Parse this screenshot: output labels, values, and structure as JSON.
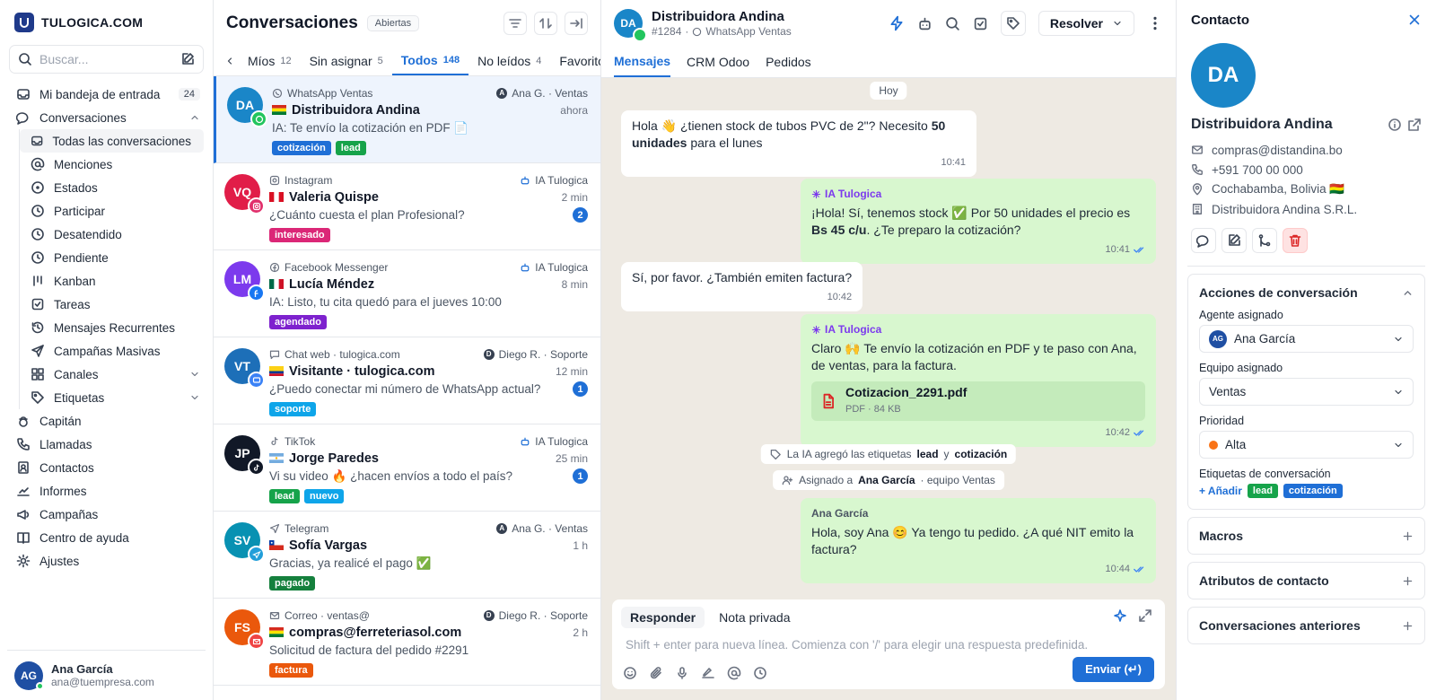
{
  "brand": {
    "name": "TULOGICA.COM"
  },
  "sidebar": {
    "search_placeholder": "Buscar...",
    "items": [
      {
        "label": "Mi bandeja de entrada",
        "count": "24"
      },
      {
        "label": "Conversaciones"
      },
      {
        "label": "Todas las conversaciones"
      },
      {
        "label": "Menciones"
      },
      {
        "label": "Estados"
      },
      {
        "label": "Participar"
      },
      {
        "label": "Desatendido"
      },
      {
        "label": "Pendiente"
      },
      {
        "label": "Kanban"
      },
      {
        "label": "Tareas"
      },
      {
        "label": "Mensajes Recurrentes"
      },
      {
        "label": "Campañas Masivas"
      },
      {
        "label": "Canales"
      },
      {
        "label": "Etiquetas"
      },
      {
        "label": "Capitán"
      },
      {
        "label": "Llamadas"
      },
      {
        "label": "Contactos"
      },
      {
        "label": "Informes"
      },
      {
        "label": "Campañas"
      },
      {
        "label": "Centro de ayuda"
      },
      {
        "label": "Ajustes"
      }
    ],
    "user": {
      "initials": "AG",
      "name": "Ana García",
      "email": "ana@tuempresa.com"
    }
  },
  "list": {
    "title": "Conversaciones",
    "status": "Abiertas",
    "tabs": [
      {
        "label": "Míos",
        "count": "12"
      },
      {
        "label": "Sin asignar",
        "count": "5"
      },
      {
        "label": "Todos",
        "count": "148"
      },
      {
        "label": "No leídos",
        "count": "4"
      },
      {
        "label": "Favoritos",
        "count": ""
      }
    ],
    "conversations": [
      {
        "initials": "DA",
        "channel": "WhatsApp Ventas",
        "agent": "Ana G. · Ventas",
        "agent_initial": "A",
        "name": "Distribuidora Andina",
        "time": "ahora",
        "preview": "IA: Te envío la cotización en PDF 📄",
        "unread": "",
        "tags": [
          {
            "label": "cotización",
            "color": "#1f6fd6"
          },
          {
            "label": "lead",
            "color": "#16a34a"
          }
        ]
      },
      {
        "initials": "VQ",
        "channel": "Instagram",
        "agent": "IA Tulogica",
        "agent_initial": "",
        "name": "Valeria Quispe",
        "time": "2 min",
        "preview": "¿Cuánto cuesta el plan Profesional?",
        "unread": "2",
        "tags": [
          {
            "label": "interesado",
            "color": "#db2777"
          }
        ]
      },
      {
        "initials": "LM",
        "channel": "Facebook Messenger",
        "agent": "IA Tulogica",
        "agent_initial": "",
        "name": "Lucía Méndez",
        "time": "8 min",
        "preview": "IA: Listo, tu cita quedó para el jueves 10:00",
        "unread": "",
        "tags": [
          {
            "label": "agendado",
            "color": "#7e22ce"
          }
        ]
      },
      {
        "initials": "VT",
        "channel": "Chat web · tulogica.com",
        "agent": "Diego R. · Soporte",
        "agent_initial": "D",
        "name": "Visitante · tulogica.com",
        "time": "12 min",
        "preview": "¿Puedo conectar mi número de WhatsApp actual?",
        "unread": "1",
        "tags": [
          {
            "label": "soporte",
            "color": "#0ea5e9"
          }
        ]
      },
      {
        "initials": "JP",
        "channel": "TikTok",
        "agent": "IA Tulogica",
        "agent_initial": "",
        "name": "Jorge Paredes",
        "time": "25 min",
        "preview": "Vi su video 🔥 ¿hacen envíos a todo el país?",
        "unread": "1",
        "tags": [
          {
            "label": "lead",
            "color": "#16a34a"
          },
          {
            "label": "nuevo",
            "color": "#0ea5e9"
          }
        ]
      },
      {
        "initials": "SV",
        "channel": "Telegram",
        "agent": "Ana G. · Ventas",
        "agent_initial": "A",
        "name": "Sofía Vargas",
        "time": "1 h",
        "preview": "Gracias, ya realicé el pago ✅",
        "unread": "",
        "tags": [
          {
            "label": "pagado",
            "color": "#15803d"
          }
        ]
      },
      {
        "initials": "FS",
        "channel": "Correo · ventas@",
        "agent": "Diego R. · Soporte",
        "agent_initial": "D",
        "name": "compras@ferreteriasol.com",
        "time": "2 h",
        "preview": "Solicitud de factura del pedido #2291",
        "unread": "",
        "tags": [
          {
            "label": "factura",
            "color": "#ea580c"
          }
        ]
      }
    ]
  },
  "chat": {
    "initials": "DA",
    "name": "Distribuidora Andina",
    "id": "#1284",
    "channel": "WhatsApp Ventas",
    "resolve_label": "Resolver",
    "tabs": [
      "Mensajes",
      "CRM Odoo",
      "Pedidos"
    ],
    "day": "Hoy",
    "m1": {
      "pre": "Hola 👋 ¿tienen stock de tubos PVC de 2\"? Necesito ",
      "bold": "50 unidades",
      "post": " para el lunes",
      "time": "10:41"
    },
    "m2": {
      "sender": "IA Tulogica",
      "pre": "¡Hola! Sí, tenemos stock ✅ Por 50 unidades el precio es ",
      "bold": "Bs 45 c/u",
      "post": ". ¿Te preparo la cotización?",
      "time": "10:41"
    },
    "m3": {
      "text": "Sí, por favor. ¿También emiten factura?",
      "time": "10:42"
    },
    "m4": {
      "sender": "IA Tulogica",
      "text": "Claro 🙌 Te envío la cotización en PDF y te paso con Ana, de ventas, para la factura.",
      "file_name": "Cotizacion_2291.pdf",
      "file_meta": "PDF · 84 KB",
      "time": "10:42"
    },
    "sys1": {
      "pre": "La IA agregó las etiquetas",
      "t1": "lead",
      "mid": "y",
      "t2": "cotización"
    },
    "sys2": {
      "pre": "Asignado a",
      "who": "Ana García",
      "post": "· equipo Ventas"
    },
    "m5": {
      "sender": "Ana García",
      "text": "Hola, soy Ana 😊 Ya tengo tu pedido. ¿A qué NIT emito la factura?",
      "time": "10:44"
    },
    "composer": {
      "reply": "Responder",
      "note": "Nota privada",
      "placeholder": "Shift + enter para nueva línea. Comienza con '/' para elegir una respuesta predefinida.",
      "send": "Enviar (↵)"
    }
  },
  "contact": {
    "title": "Contacto",
    "initials": "DA",
    "name": "Distribuidora Andina",
    "email": "compras@distandina.bo",
    "phone": "+591 700 00 000",
    "location": "Cochabamba, Bolivia 🇧🇴",
    "company": "Distribuidora Andina S.R.L.",
    "actions_title": "Acciones de conversación",
    "agent_label": "Agente asignado",
    "agent_initials": "AG",
    "agent_value": "Ana García",
    "team_label": "Equipo asignado",
    "team_value": "Ventas",
    "priority_label": "Prioridad",
    "priority_value": "Alta",
    "labels_label": "Etiquetas de conversación",
    "add_label": "+ Añadir",
    "tags": [
      {
        "label": "lead",
        "color": "#16a34a"
      },
      {
        "label": "cotización",
        "color": "#1f6fd6"
      }
    ],
    "sections": [
      "Macros",
      "Atributos de contacto",
      "Conversaciones anteriores"
    ]
  }
}
